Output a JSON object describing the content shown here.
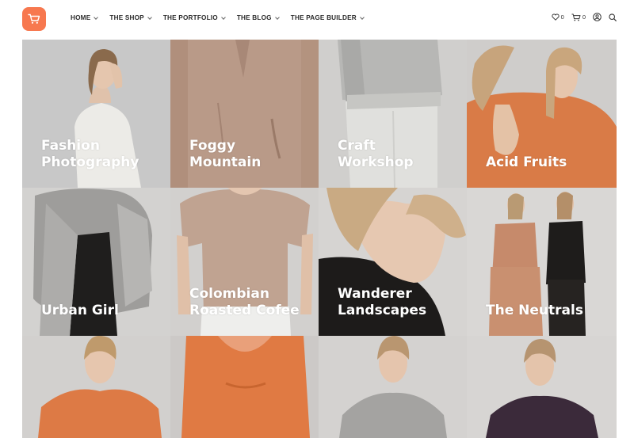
{
  "brand": {
    "accent": "#f7784f",
    "logo_icon": "shopping-cart-icon"
  },
  "nav": {
    "items": [
      {
        "label": "HOME"
      },
      {
        "label": "THE SHOP"
      },
      {
        "label": "THE PORTFOLIO"
      },
      {
        "label": "THE BLOG"
      },
      {
        "label": "THE PAGE BUILDER"
      }
    ]
  },
  "header_tools": {
    "wishlist_count": "0",
    "cart_count": "0",
    "icons": [
      "heart-icon",
      "cart-icon",
      "user-icon",
      "search-icon"
    ]
  },
  "portfolio": {
    "tiles": [
      {
        "title": "Fashion\nPhotography"
      },
      {
        "title": "Foggy\nMountain"
      },
      {
        "title": "Craft\nWorkshop"
      },
      {
        "title": "Acid Fruits"
      },
      {
        "title": "Urban Girl"
      },
      {
        "title": "Colombian\nRoasted Cofee"
      },
      {
        "title": "Wanderer\nLandscapes"
      },
      {
        "title": "The Neutrals"
      },
      {
        "title": ""
      },
      {
        "title": ""
      },
      {
        "title": ""
      },
      {
        "title": ""
      }
    ]
  }
}
